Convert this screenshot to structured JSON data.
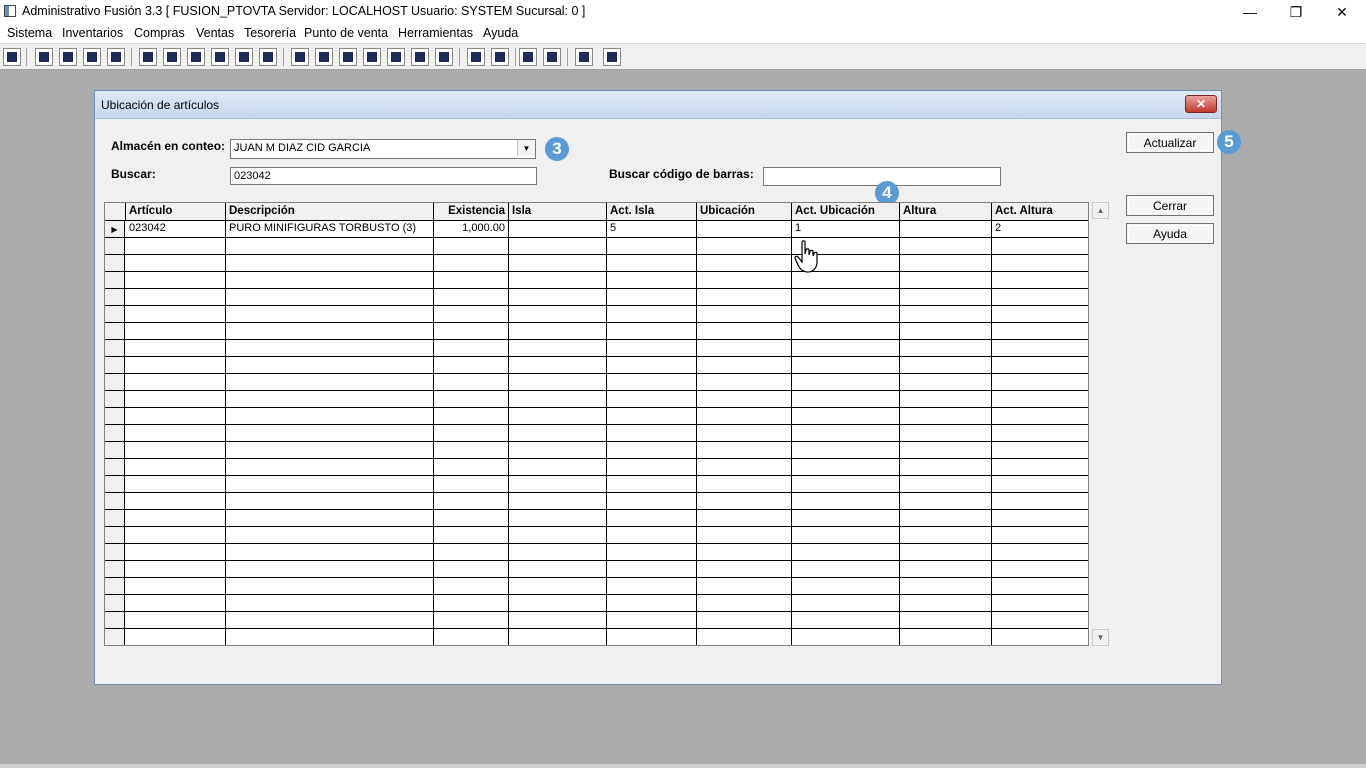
{
  "window": {
    "title": "Administrativo Fusión 3.3 [ FUSION_PTOVTA   Servidor: LOCALHOST   Usuario: SYSTEM     Sucursal: 0 ]",
    "minimize_glyph": "—",
    "maximize_glyph": "❐",
    "close_glyph": "✕"
  },
  "menu": {
    "items": [
      "Sistema",
      "Inventarios",
      "Compras",
      "Ventas",
      "Tesorería",
      "Punto de venta",
      "Herramientas",
      "Ayuda"
    ]
  },
  "toolbar": {
    "icons": [
      "calculator-icon",
      "copy-icon",
      "clipboard-icon",
      "transfer-icon",
      "search-icon",
      "user-icon",
      "folder-icon",
      "import-icon",
      "print-icon",
      "document-icon",
      "list-icon",
      "binoculars-icon",
      "card-icon",
      "export-icon",
      "add-icon",
      "money-icon",
      "report-icon",
      "table-icon",
      "home-icon",
      "zoom-icon",
      "refresh-icon",
      "undo-icon",
      "back-icon",
      "help-icon"
    ]
  },
  "dialog": {
    "title": "Ubicación de artículos",
    "close_glyph": "✕",
    "almacen_label": "Almacén en conteo:",
    "almacen_value": "JUAN M DIAZ CID GARCIA",
    "buscar_label": "Buscar:",
    "buscar_value": "023042",
    "barcode_label": "Buscar código de barras:",
    "barcode_value": "",
    "badges": [
      "3",
      "4",
      "5"
    ],
    "buttons": {
      "actualizar": "Actualizar",
      "cerrar": "Cerrar",
      "ayuda": "Ayuda"
    },
    "grid": {
      "columns": [
        "Artículo",
        "Descripción",
        "Existencia",
        "Isla",
        "Act. Isla",
        "Ubicación",
        "Act. Ubicación",
        "Altura",
        "Act. Altura"
      ],
      "rows": [
        [
          "023042",
          "PURO MINIFIGURAS TORBUSTO (3)",
          "1,000.00",
          "",
          "5",
          "",
          "1",
          "",
          "2"
        ]
      ],
      "current_row_marker": "▶",
      "scroll_up": "▲",
      "scroll_down": "▼"
    }
  }
}
